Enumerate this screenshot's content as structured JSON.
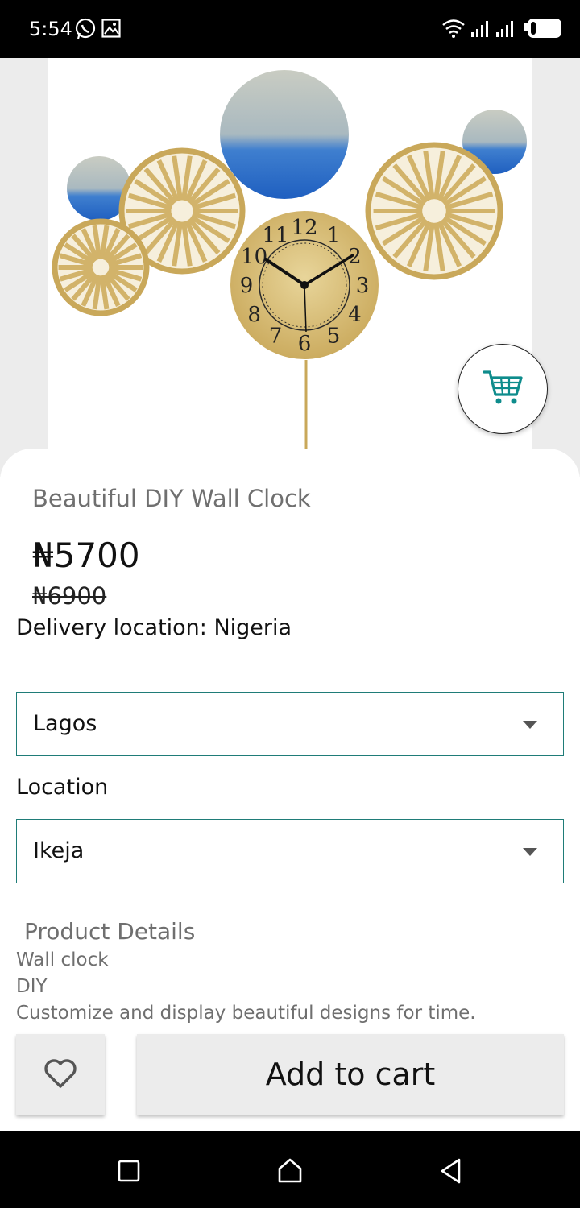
{
  "status_bar": {
    "time": "5:54",
    "icons": [
      "whatsapp-icon",
      "image-icon",
      "wifi-icon",
      "signal-icon",
      "signal-icon",
      "battery-icon"
    ]
  },
  "product": {
    "title": "Beautiful DIY Wall Clock",
    "price": "₦5700",
    "old_price": "₦6900",
    "delivery": "Delivery location: Nigeria"
  },
  "state_select": {
    "value": "Lagos"
  },
  "location": {
    "label": "Location",
    "value": "Ikeja"
  },
  "details": {
    "title": "Product Details",
    "lines": [
      "Wall clock",
      "DIY",
      "Customize and display beautiful designs for time."
    ]
  },
  "actions": {
    "add_to_cart": "Add to cart"
  },
  "clock_numerals": [
    "12",
    "1",
    "2",
    "3",
    "4",
    "5",
    "6",
    "7",
    "8",
    "9",
    "10",
    "11"
  ],
  "colors": {
    "accent": "#1f7c78",
    "cart_icon": "#0e8c8c",
    "button_bg": "#ececec"
  }
}
